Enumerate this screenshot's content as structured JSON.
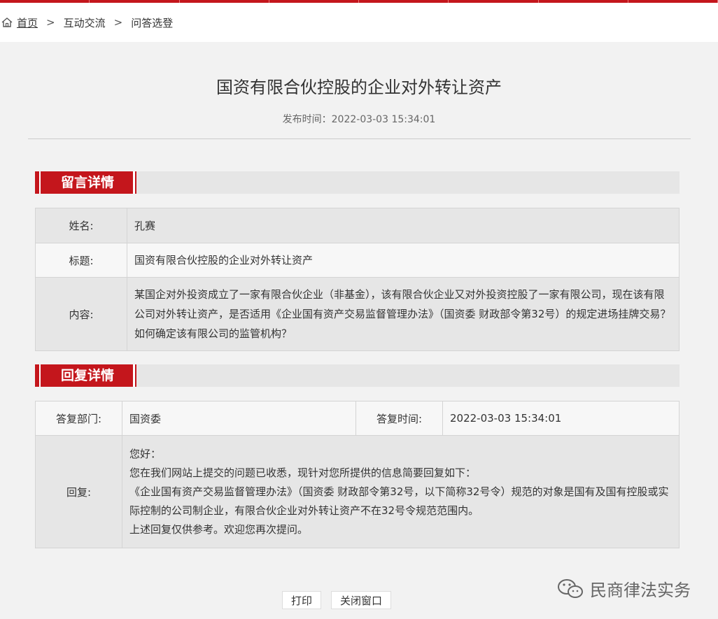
{
  "breadcrumb": {
    "home": "首页",
    "sep1": ">",
    "item1": "互动交流",
    "sep2": ">",
    "item2": "问答选登"
  },
  "article": {
    "title": "国资有限合伙控股的企业对外转让资产",
    "publish_time": "发布时间：2022-03-03 15:34:01"
  },
  "message_section": {
    "heading": "留言详情",
    "name_label": "姓名:",
    "name_value": "孔赛",
    "title_label": "标题:",
    "title_value": "国资有限合伙控股的企业对外转让资产",
    "content_label": "内容:",
    "content_value": "某国企对外投资成立了一家有限合伙企业（非基金），该有限合伙企业又对外投资控股了一家有限公司，现在该有限公司对外转让资产，是否适用《企业国有资产交易监督管理办法》（国资委 财政部令第32号）的规定进场挂牌交易？如何确定该有限公司的监管机构？"
  },
  "reply_section": {
    "heading": "回复详情",
    "dept_label": "答复部门:",
    "dept_value": "国资委",
    "time_label": "答复时间:",
    "time_value": "2022-03-03 15:34:01",
    "reply_label": "回复:",
    "reply_lines": [
      "您好：",
      "您在我们网站上提交的问题已收悉，现针对您所提供的信息简要回复如下：",
      "《企业国有资产交易监督管理办法》（国资委 财政部令第32号，以下简称32号令）规范的对象是国有及国有控股或实际控制的公司制企业，有限合伙企业对外转让资产不在32号令规范范围内。",
      "上述回复仅供参考。欢迎您再次提问。"
    ]
  },
  "actions": {
    "print": "打印",
    "close": "关闭窗口"
  },
  "watermark": {
    "text": "民商律法实务",
    "icon": "wechat-icon"
  },
  "colors": {
    "accent": "#c4161c"
  }
}
